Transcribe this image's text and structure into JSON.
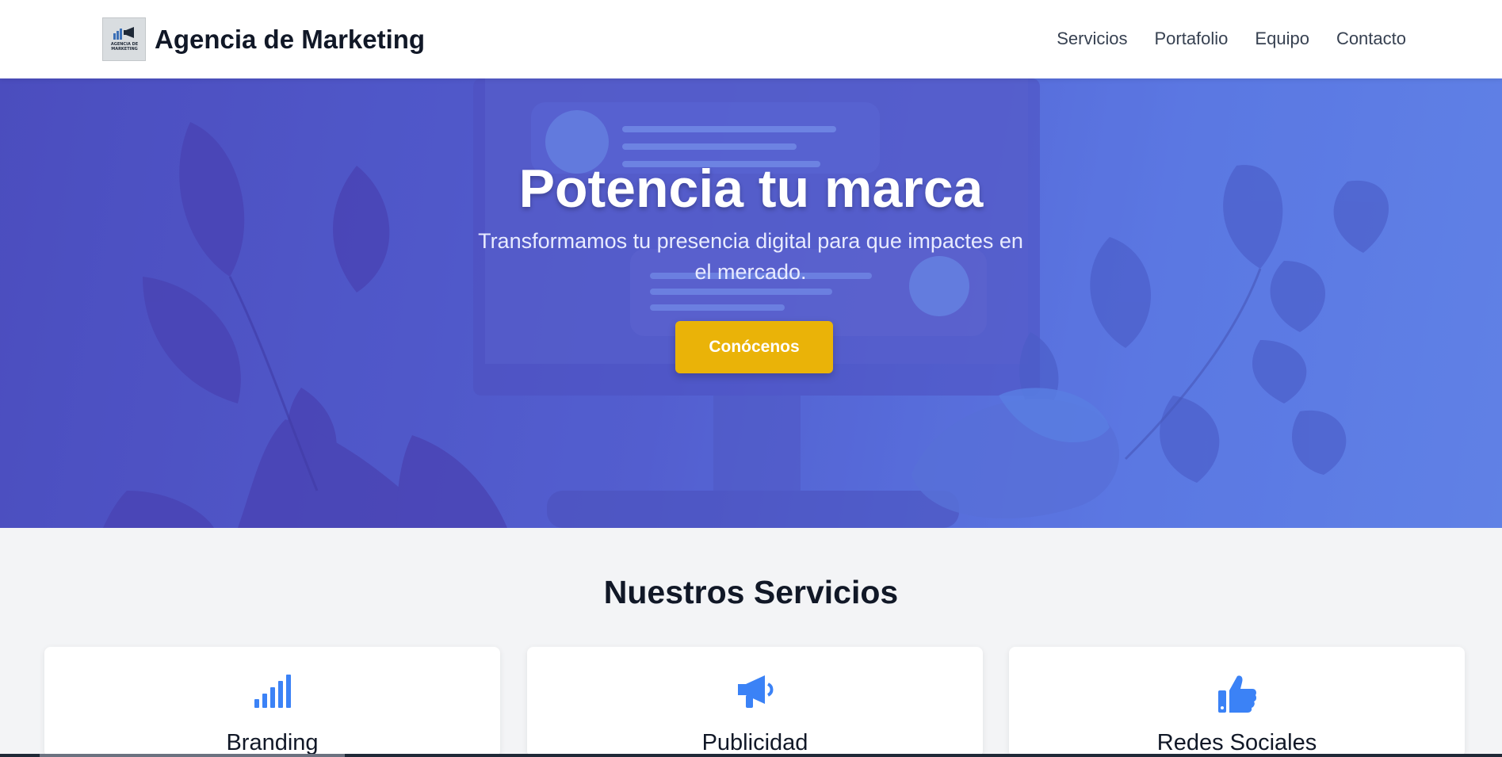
{
  "header": {
    "logo_text": "AGENCIA DE MARKETING",
    "title": "Agencia de Marketing",
    "nav": [
      {
        "label": "Servicios"
      },
      {
        "label": "Portafolio"
      },
      {
        "label": "Equipo"
      },
      {
        "label": "Contacto"
      }
    ]
  },
  "hero": {
    "title": "Potencia tu marca",
    "subtitle": "Transformamos tu presencia digital para que impactes en el mercado.",
    "cta_label": "Conócenos"
  },
  "services": {
    "title": "Nuestros Servicios",
    "cards": [
      {
        "title": "Branding",
        "icon": "signal-bars-icon"
      },
      {
        "title": "Publicidad",
        "icon": "megaphone-icon"
      },
      {
        "title": "Redes Sociales",
        "icon": "thumbs-up-icon"
      }
    ]
  },
  "colors": {
    "accent_blue": "#3b82f6",
    "cta_yellow": "#eab308",
    "hero_gradient_start": "#4c4cbe",
    "hero_gradient_end": "#6489ec"
  }
}
